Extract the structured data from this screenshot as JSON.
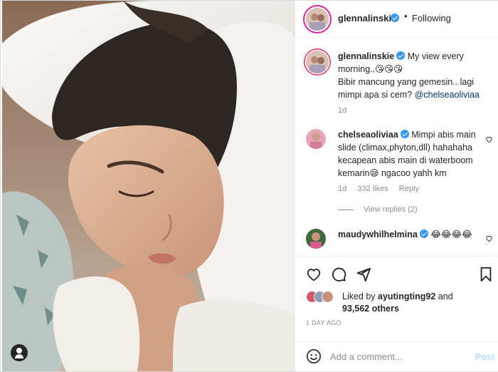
{
  "post": {
    "author": "glennalinskie",
    "separator": "•",
    "follow_status": "Following"
  },
  "caption": {
    "username": "glennalinskie",
    "text_line1": "My view every morning..",
    "emoji": "😘😘😘",
    "text_line2": "Bibir mancung yang gemesin.. lagi",
    "text_line3_prefix": "mimpi apa si cem? ",
    "mention": "@chelseaoliviaa",
    "age": "1d"
  },
  "comments": [
    {
      "username": "chelseaoliviaa",
      "text_line1": "Mimpi abis main",
      "text_line2": "slide (climax,phyton,dll) hahahaha",
      "text_line3": "kecapean abis main di waterboom",
      "text_line4": "kemarin😪 ngacoo yahh km",
      "age": "1d",
      "likes": "332 likes",
      "reply": "Reply",
      "view_replies": "View replies (2)"
    },
    {
      "username": "maudywhilhelmina",
      "text": "😂😂😂😂"
    }
  ],
  "likes": {
    "prefix": "Liked by ",
    "user": "ayutingting92",
    "middle": " and",
    "count": "93,562 others"
  },
  "timestamp": "1 DAY AGO",
  "add_comment": {
    "placeholder": "Add a comment...",
    "post_label": "Post"
  },
  "colors": {
    "verified": "#3897f0",
    "story_ring": "#d6249f",
    "post_disabled": "#b2dffc",
    "mention": "#00376b",
    "muted": "#8e8e8e"
  },
  "icons": [
    "heart-icon",
    "comment-icon",
    "share-icon",
    "bookmark-icon",
    "emoji-icon",
    "user-tag-icon",
    "verified-badge-icon"
  ]
}
